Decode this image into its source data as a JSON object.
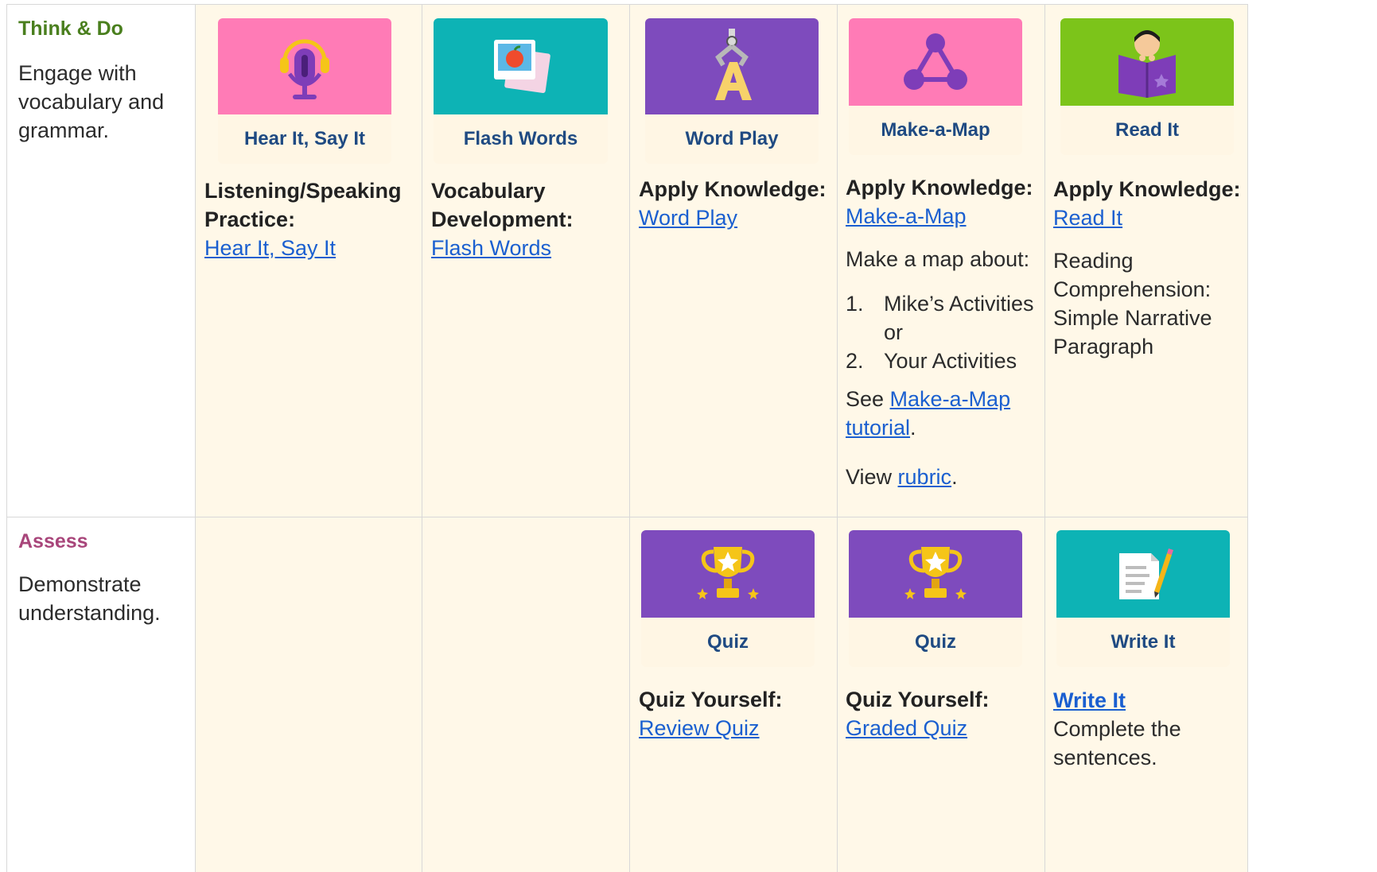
{
  "rows": {
    "think": {
      "label": "Think & Do",
      "label_color": "#4a7f1e",
      "description": "Engage with vocabulary and grammar."
    },
    "assess": {
      "label": "Assess",
      "label_color": "#a8457a",
      "description": "Demonstrate understanding."
    }
  },
  "think_cells": {
    "hear": {
      "card_title": "Hear It, Say It",
      "card_color": "#ff7bb6",
      "icon": "microphone-headphones-icon",
      "heading": "Listening/Speaking Practice:",
      "link": "Hear It, Say It"
    },
    "flash": {
      "card_title": "Flash Words",
      "card_color": "#0db3b5",
      "icon": "flash-cards-apple-icon",
      "heading": "Vocabulary Development:",
      "link": "Flash Words"
    },
    "wordplay": {
      "card_title": "Word Play",
      "card_color": "#7e4bbd",
      "icon": "letter-a-claw-icon",
      "heading": "Apply Knowledge:",
      "link": "Word Play"
    },
    "map": {
      "card_title": "Make-a-Map",
      "card_color": "#ff7bb6",
      "icon": "node-graph-icon",
      "heading": "Apply Knowledge:",
      "link": "Make-a-Map",
      "intro": "Make a map about:",
      "items": [
        {
          "num": "1.",
          "text": "Mike’s Activities or"
        },
        {
          "num": "2.",
          "text": "Your Activities"
        }
      ],
      "see_prefix": "See ",
      "see_link": "Make-a-Map tutorial",
      "see_suffix": ".",
      "view_prefix": "View ",
      "view_link": "rubric",
      "view_suffix": "."
    },
    "read": {
      "card_title": "Read It",
      "card_color": "#7cc41a",
      "icon": "child-reading-book-icon",
      "heading": "Apply Knowledge:",
      "link": "Read It",
      "body": "Reading Comprehension: Simple Narrative Paragraph"
    }
  },
  "assess_cells": {
    "review": {
      "card_title": "Quiz",
      "card_color": "#7e4bbd",
      "icon": "trophy-icon",
      "heading": "Quiz Yourself:",
      "link": "Review Quiz"
    },
    "graded": {
      "card_title": "Quiz",
      "card_color": "#7e4bbd",
      "icon": "trophy-icon",
      "heading": "Quiz Yourself:",
      "link": "Graded Quiz"
    },
    "write": {
      "card_title": "Write It",
      "card_color": "#0db3b5",
      "icon": "document-pencil-icon",
      "link": "Write It",
      "body": "Complete the sentences."
    }
  }
}
